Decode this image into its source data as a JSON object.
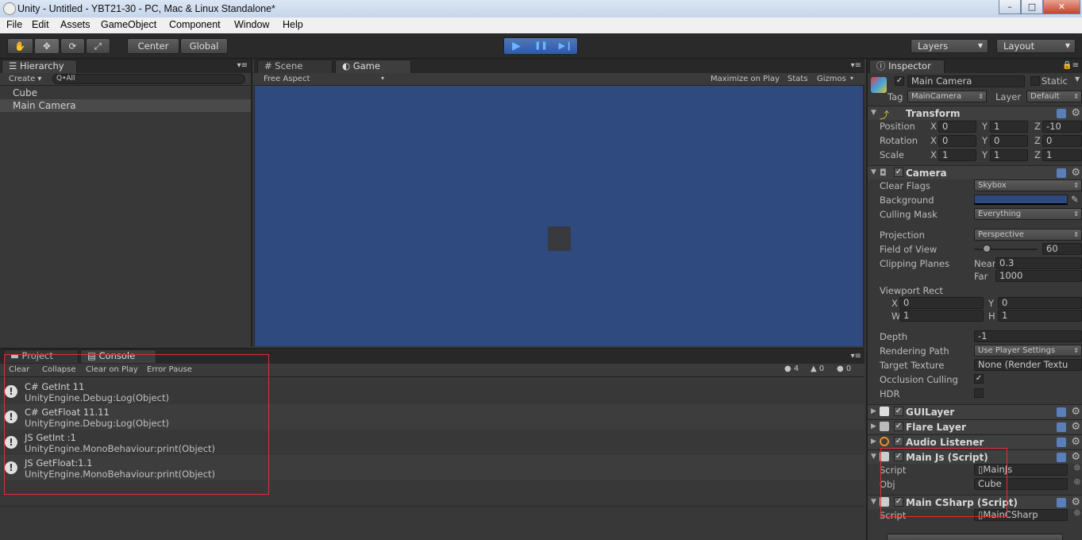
{
  "window": {
    "title": "Unity - Untitled - YBT21-30 - PC, Mac & Linux Standalone*",
    "minimize": "–",
    "maximize": "□",
    "close": "✕"
  },
  "menu": [
    "File",
    "Edit",
    "Assets",
    "GameObject",
    "Component",
    "Window",
    "Help"
  ],
  "toolbar": {
    "tools": [
      "hand-icon",
      "move-icon",
      "rotate-icon",
      "scale-icon"
    ],
    "pivot": "Center",
    "space": "Global",
    "play": "▶",
    "pause": "❚❚",
    "step": "▶❙",
    "layers": "Layers",
    "layout": "Layout"
  },
  "hierarchy": {
    "tab": "Hierarchy",
    "create": "Create",
    "search_placeholder": "Q•All",
    "items": [
      "Cube",
      "Main Camera"
    ]
  },
  "scene_tab": "Scene",
  "game": {
    "tab": "Game",
    "aspect": "Free Aspect",
    "maximize": "Maximize on Play",
    "stats": "Stats",
    "gizmos": "Gizmos"
  },
  "console": {
    "tabs": [
      "Project",
      "Console"
    ],
    "buttons": [
      "Clear",
      "Collapse",
      "Clear on Play",
      "Error Pause"
    ],
    "counts": {
      "info": "4",
      "warning": "0",
      "error": "0"
    },
    "logs": [
      {
        "line1": "C# GetInt  11",
        "line2": "UnityEngine.Debug:Log(Object)"
      },
      {
        "line1": "C# GetFloat  11.11",
        "line2": "UnityEngine.Debug:Log(Object)"
      },
      {
        "line1": "JS GetInt  :1",
        "line2": "UnityEngine.MonoBehaviour:print(Object)"
      },
      {
        "line1": "JS GetFloat:1.1",
        "line2": "UnityEngine.MonoBehaviour:print(Object)"
      }
    ]
  },
  "inspector": {
    "tab": "Inspector",
    "object_name": "Main Camera",
    "static": "Static",
    "tag_label": "Tag",
    "tag": "MainCamera",
    "layer_label": "Layer",
    "layer": "Default",
    "transform": {
      "title": "Transform",
      "rows": [
        {
          "label": "Position",
          "x": "0",
          "y": "1",
          "z": "-10"
        },
        {
          "label": "Rotation",
          "x": "0",
          "y": "0",
          "z": "0"
        },
        {
          "label": "Scale",
          "x": "1",
          "y": "1",
          "z": "1"
        }
      ]
    },
    "camera": {
      "title": "Camera",
      "clear_flags_label": "Clear Flags",
      "clear_flags": "Skybox",
      "background_label": "Background",
      "background_color": "#2f4a7e",
      "culling_label": "Culling Mask",
      "culling": "Everything",
      "projection_label": "Projection",
      "projection": "Perspective",
      "fov_label": "Field of View",
      "fov": "60",
      "fov_fraction": 0.2,
      "clipping_label": "Clipping Planes",
      "near_label": "Near",
      "near": "0.3",
      "far_label": "Far",
      "far": "1000",
      "viewport_label": "Viewport Rect",
      "vx": "0",
      "vy": "0",
      "vw": "1",
      "vh": "1",
      "depth_label": "Depth",
      "depth": "-1",
      "rendering_label": "Rendering Path",
      "rendering": "Use Player Settings",
      "target_label": "Target Texture",
      "target": "None (Render Textu",
      "occlusion_label": "Occlusion Culling",
      "hdr_label": "HDR"
    },
    "components": [
      "GUILayer",
      "Flare Layer",
      "Audio Listener",
      "Main Js (Script)",
      "Main CSharp (Script)"
    ],
    "mainjs": {
      "script_label": "Script",
      "script": "MainJs",
      "obj_label": "Obj",
      "obj": "Cube"
    },
    "maincsharp": {
      "script_label": "Script",
      "script": "MainCSharp"
    }
  }
}
